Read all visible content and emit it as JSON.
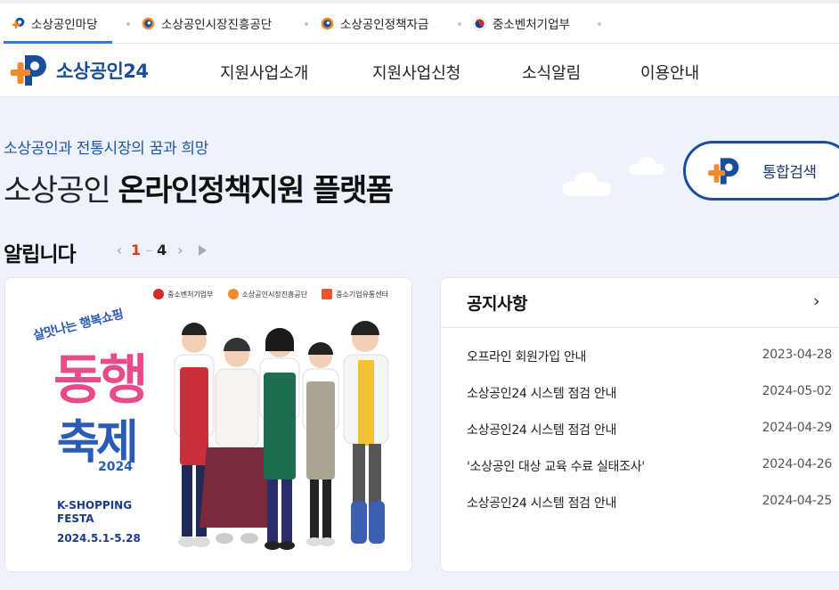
{
  "topbar": {
    "sites": [
      {
        "label": "소상공인마당",
        "icon": "sosang-logo-icon"
      },
      {
        "label": "소상공인시장진흥공단",
        "icon": "semas-logo-icon"
      },
      {
        "label": "소상공인정책자금",
        "icon": "semas-logo-icon"
      },
      {
        "label": "중소벤처기업부",
        "icon": "taegeuk-icon"
      }
    ]
  },
  "nav": {
    "logo": "소상공인24",
    "menu": [
      "지원사업소개",
      "지원사업신청",
      "소식알림",
      "이용안내"
    ]
  },
  "hero": {
    "subtitle": "소상공인과 전통시장의 꿈과 희망",
    "title_light": "소상공인",
    "title_bold": "온라인정책지원 플랫폼"
  },
  "search": {
    "label": "통합검색"
  },
  "alerts": {
    "title": "알립니다",
    "page_current": "1",
    "page_sep": "–",
    "page_total": "4"
  },
  "banner": {
    "logos": [
      "중소벤처기업부",
      "소상공인시장진흥공단",
      "중소기업유통센터"
    ],
    "arc_text": "살맛나는 행복쇼핑",
    "big1": "동행",
    "big2": "축제",
    "year": "2024",
    "eng1": "K-SHOPPING",
    "eng2": "FESTA",
    "date": "2024.5.1-5.28"
  },
  "notice": {
    "title": "공지사항",
    "more_icon": "chevron-right-icon",
    "items": [
      {
        "title": "오프라인 회원가입 안내",
        "date": "2023-04-28"
      },
      {
        "title": "소상공인24 시스템 점검 안내",
        "date": "2024-05-02"
      },
      {
        "title": "소상공인24 시스템 점검 안내",
        "date": "2024-04-29"
      },
      {
        "title": "'소상공인 대상 교육 수료 실태조사'",
        "date": "2024-04-26"
      },
      {
        "title": "소상공인24 시스템 점검 안내",
        "date": "2024-04-25"
      }
    ]
  },
  "colors": {
    "brand_blue": "#1a4e9c",
    "brand_orange": "#f08a2c",
    "accent_line": "#2c7be5"
  }
}
